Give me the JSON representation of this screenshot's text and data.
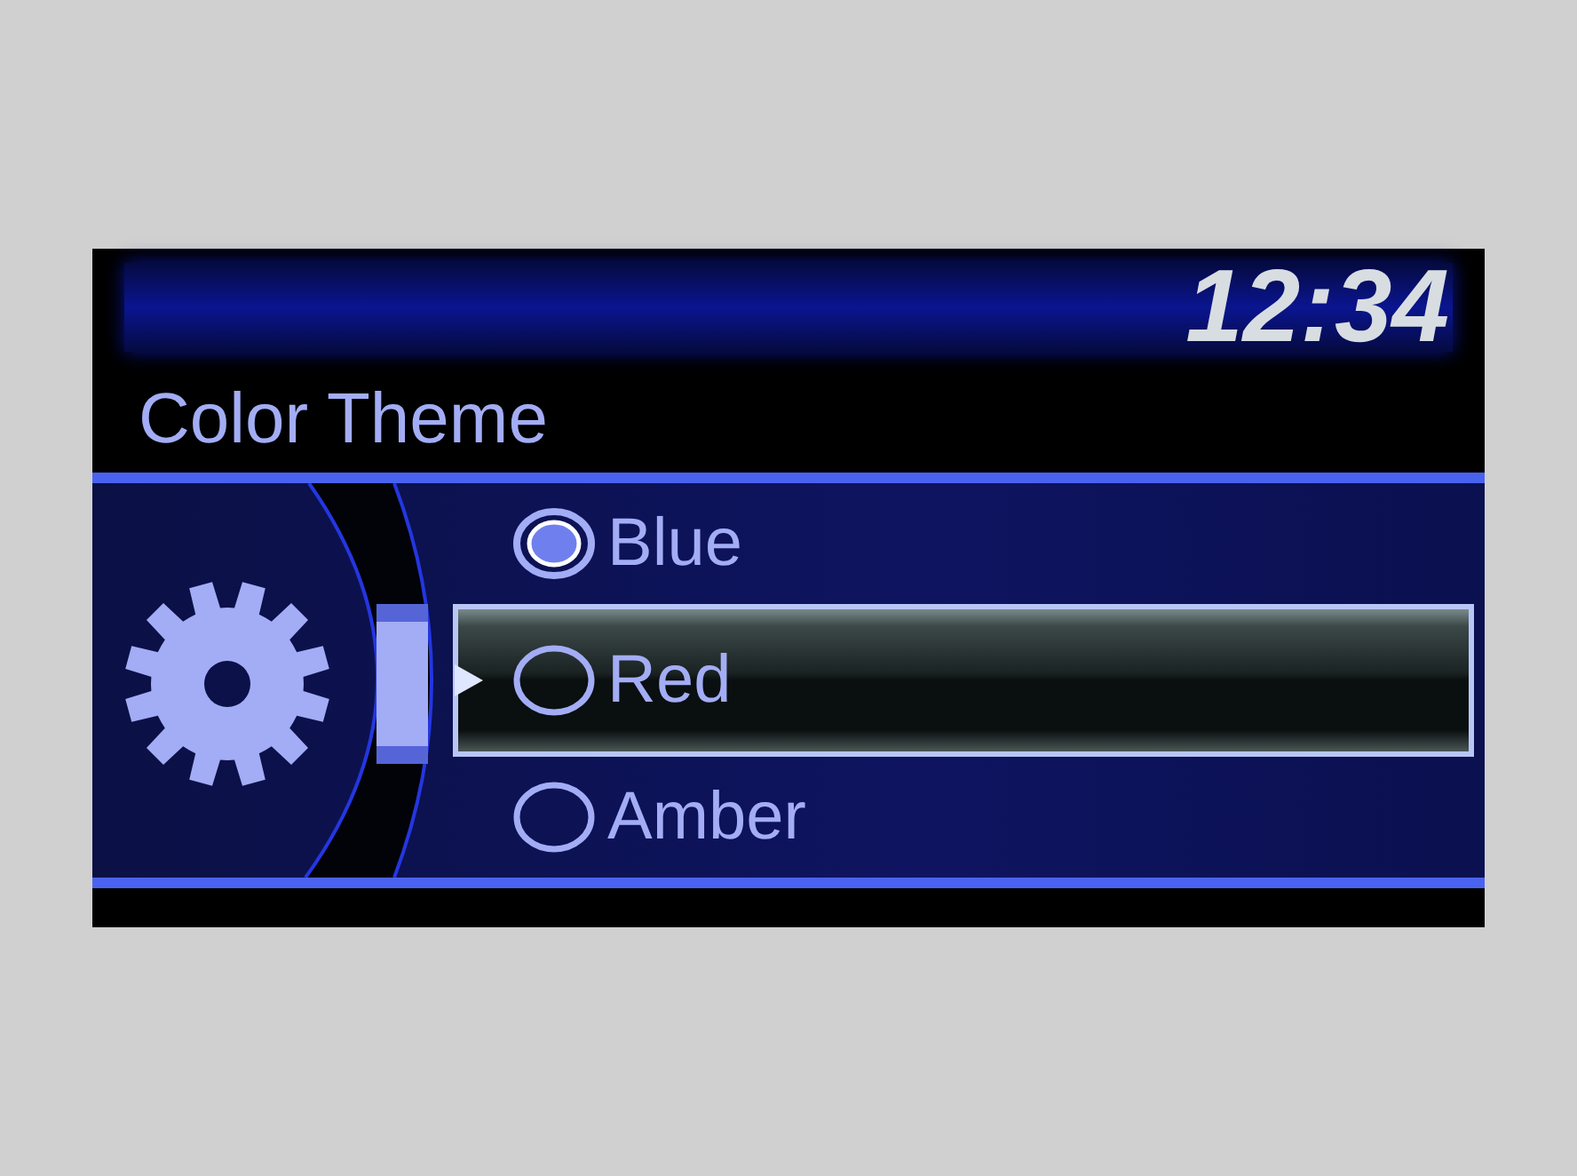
{
  "clock": "12:34",
  "title": "Color Theme",
  "options": [
    {
      "label": "Blue",
      "selected": true,
      "highlighted": false
    },
    {
      "label": "Red",
      "selected": false,
      "highlighted": true
    },
    {
      "label": "Amber",
      "selected": false,
      "highlighted": false
    }
  ]
}
